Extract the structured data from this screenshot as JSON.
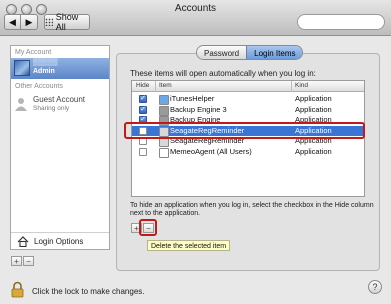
{
  "window": {
    "title": "Accounts"
  },
  "toolbar": {
    "back": "◀",
    "forward": "▶",
    "show_all": "Show All"
  },
  "sidebar": {
    "my_account_header": "My Account",
    "my_account_name": "▒▒▒▒▒",
    "my_account_role": "Admin",
    "other_accounts_header": "Other Accounts",
    "guest_name": "Guest Account",
    "guest_sub": "Sharing only",
    "login_options": "Login Options",
    "add": "+",
    "remove": "−"
  },
  "tabs": [
    "Password",
    "Login Items"
  ],
  "intro": "These items will open automatically when you log in:",
  "table": {
    "columns": [
      "Hide",
      "Item",
      "Kind"
    ],
    "rows": [
      {
        "hide": true,
        "name": "iTunesHelper",
        "kind": "Application",
        "icon_color": "#6aa8e8",
        "selected": false
      },
      {
        "hide": true,
        "name": "Backup Engine 3",
        "kind": "Application",
        "icon_color": "#9a9a9a",
        "selected": false
      },
      {
        "hide": true,
        "name": "Backup Engine",
        "kind": "Application",
        "icon_color": "#9a9a9a",
        "selected": false
      },
      {
        "hide": false,
        "name": "SeagateRegReminder",
        "kind": "Application",
        "icon_color": "#d8d8d8",
        "selected": true
      },
      {
        "hide": false,
        "name": "SeagateRegReminder",
        "kind": "Application",
        "icon_color": "#d8d8d8",
        "selected": false
      },
      {
        "hide": false,
        "name": "MemeoAgent (All Users)",
        "kind": "Application",
        "icon_color": "#ffffff",
        "selected": false
      }
    ]
  },
  "hint": "To hide an application when you log in, select the checkbox in the Hide column next to the application.",
  "table_buttons": {
    "add": "+",
    "remove": "−"
  },
  "tooltip": "Delete the selected item",
  "lock_text": "Click the lock to make changes.",
  "help": "?",
  "colors": {
    "selection": "#3875d7",
    "highlight": "#c01a1a"
  }
}
